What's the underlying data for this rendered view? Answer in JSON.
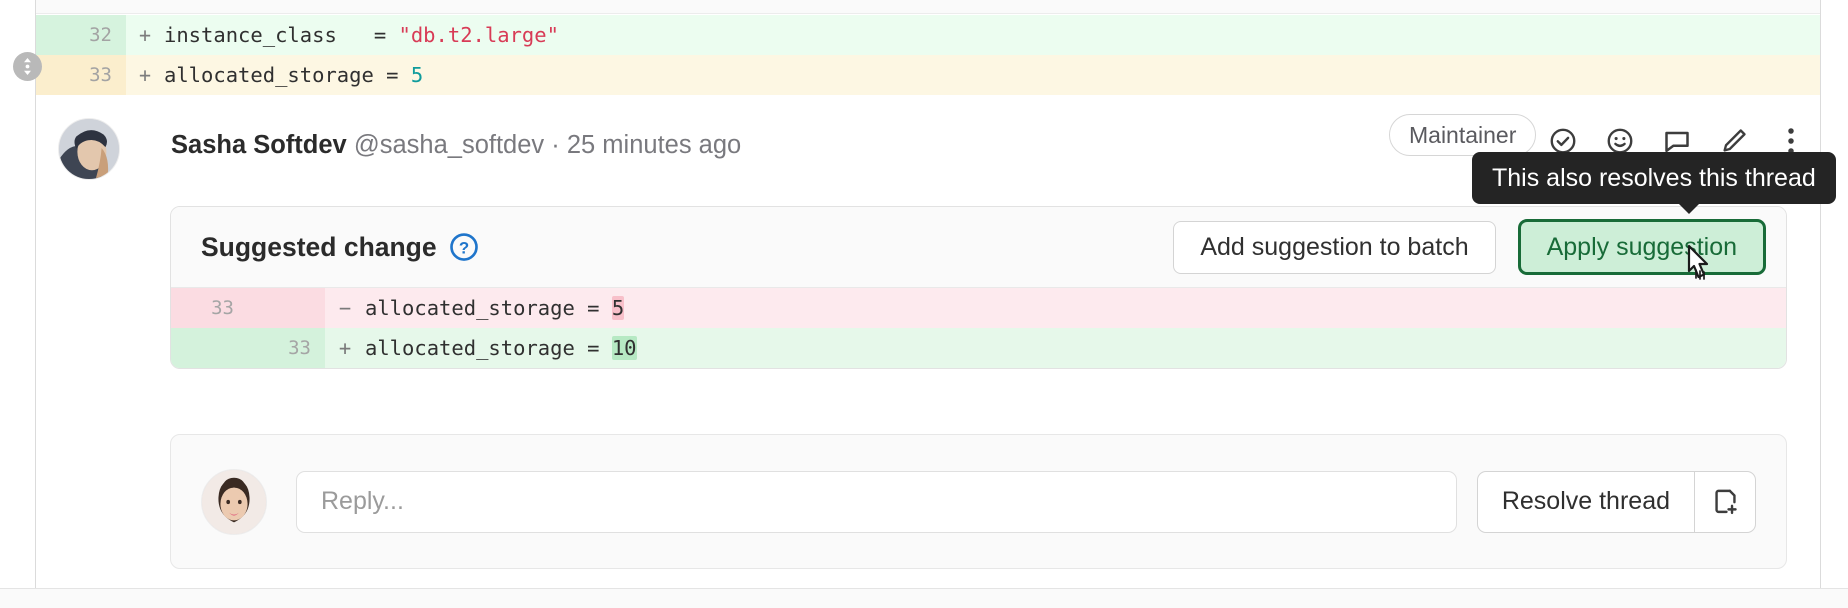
{
  "diff_context": {
    "rows": [
      {
        "line": "32",
        "marker": "+",
        "code_plain": "instance_class   = ",
        "code_value": "\"db.t2.large\"",
        "value_kind": "string",
        "state": "added"
      },
      {
        "line": "33",
        "marker": "+",
        "code_plain": "allocated_storage = ",
        "code_value": "5",
        "value_kind": "number",
        "state": "focused"
      }
    ],
    "drag_handle_icon": "resize-vertical-icon"
  },
  "comment": {
    "author": "Sasha Softdev",
    "handle": "@sasha_softdev",
    "separator": "·",
    "timestamp": "25 minutes ago",
    "badge": "Maintainer",
    "avatar_alt": "sasha-softdev-avatar",
    "actions": [
      {
        "name": "resolve-thread-icon",
        "icon": "check-circle-icon"
      },
      {
        "name": "add-reaction-icon",
        "icon": "smiley-icon"
      },
      {
        "name": "reply-icon",
        "icon": "comment-icon"
      },
      {
        "name": "edit-comment-icon",
        "icon": "pencil-icon"
      },
      {
        "name": "more-actions-icon",
        "icon": "kebab-menu-icon"
      }
    ]
  },
  "tooltip": {
    "text": "This also resolves this thread"
  },
  "suggestion": {
    "title": "Suggested change",
    "help_icon": "question-mark-circle-icon",
    "add_to_batch_label": "Add suggestion to batch",
    "apply_label": "Apply suggestion",
    "rows": [
      {
        "old_line": "33",
        "new_line": "",
        "marker": "−",
        "code_prefix": "allocated_storage = ",
        "code_highlight": "5",
        "type": "del"
      },
      {
        "old_line": "",
        "new_line": "33",
        "marker": "+",
        "code_prefix": "allocated_storage = ",
        "code_highlight": "10",
        "type": "add"
      }
    ]
  },
  "reply": {
    "avatar_alt": "current-user-avatar",
    "placeholder": "Reply...",
    "resolve_label": "Resolve thread",
    "new_issue_icon": "new-issue-icon"
  },
  "colors": {
    "diff_add_bg": "#ecfdf0",
    "diff_focus_bg": "#fdf7e3",
    "diff_del_bg": "#fdeaee",
    "apply_border": "#186b38",
    "apply_bg": "#cdeed7",
    "tooltip_bg": "#242424",
    "help_icon": "#1f75cb",
    "string_token": "#d83b56",
    "number_token": "#0f9c9c"
  }
}
